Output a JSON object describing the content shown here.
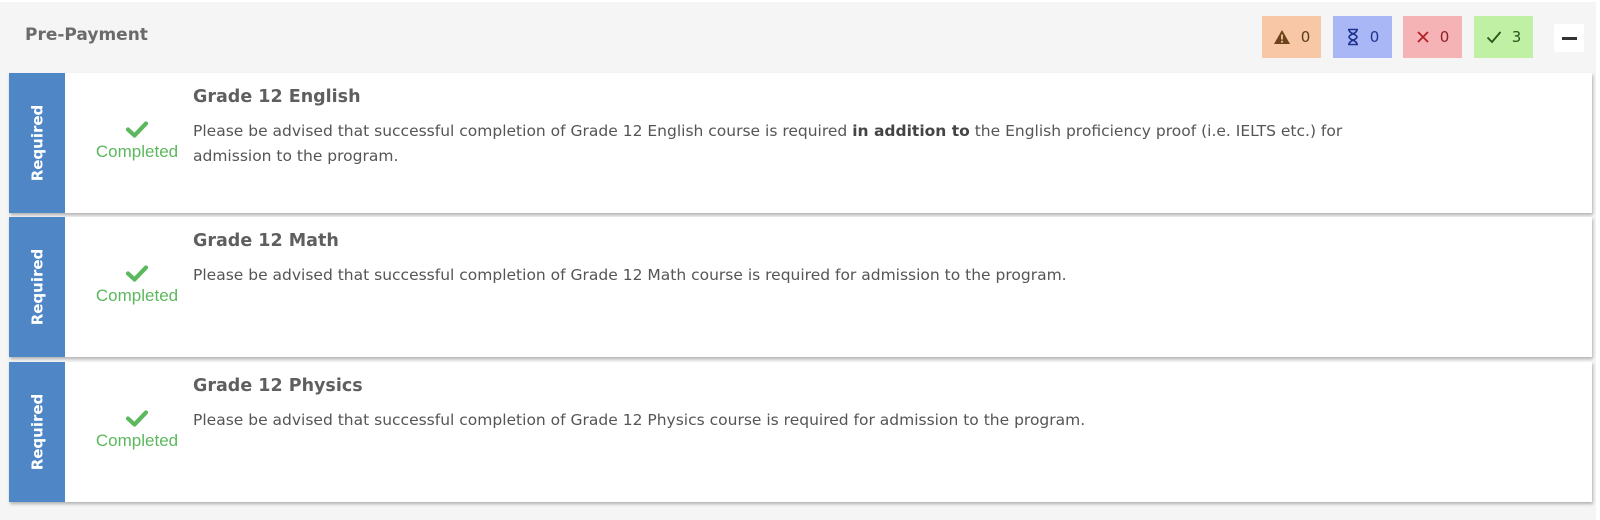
{
  "section": {
    "title": "Pre-Payment",
    "counters": {
      "warning": {
        "icon": "warning-triangle-icon",
        "count": "0",
        "color": "#f7c7a6"
      },
      "pending": {
        "icon": "hourglass-icon",
        "count": "0",
        "color": "#a9b7f6"
      },
      "failed": {
        "icon": "x-mark-icon",
        "count": "0",
        "color": "#f5b3b5"
      },
      "completed": {
        "icon": "checkmark-icon",
        "count": "3",
        "color": "#bff0a4"
      }
    },
    "collapse_icon": "minus-icon"
  },
  "requirements": [
    {
      "tag": "Required",
      "status": "Completed",
      "title": "Grade 12 English",
      "description_before": "Please be advised that successful completion of Grade 12 English course is required ",
      "description_bold": "in addition to",
      "description_after": " the English proficiency proof (i.e. IELTS etc.) for admission to the program."
    },
    {
      "tag": "Required",
      "status": "Completed",
      "title": "Grade 12 Math",
      "description": "Please be advised that successful completion of Grade 12 Math course is required for admission to the program."
    },
    {
      "tag": "Required",
      "status": "Completed",
      "title": "Grade 12 Physics",
      "description": "Please be advised that successful completion of Grade 12 Physics course is required for admission to the program."
    }
  ],
  "colors": {
    "tag_blue": "#4f86c6",
    "completed_green": "#5cb85c"
  }
}
